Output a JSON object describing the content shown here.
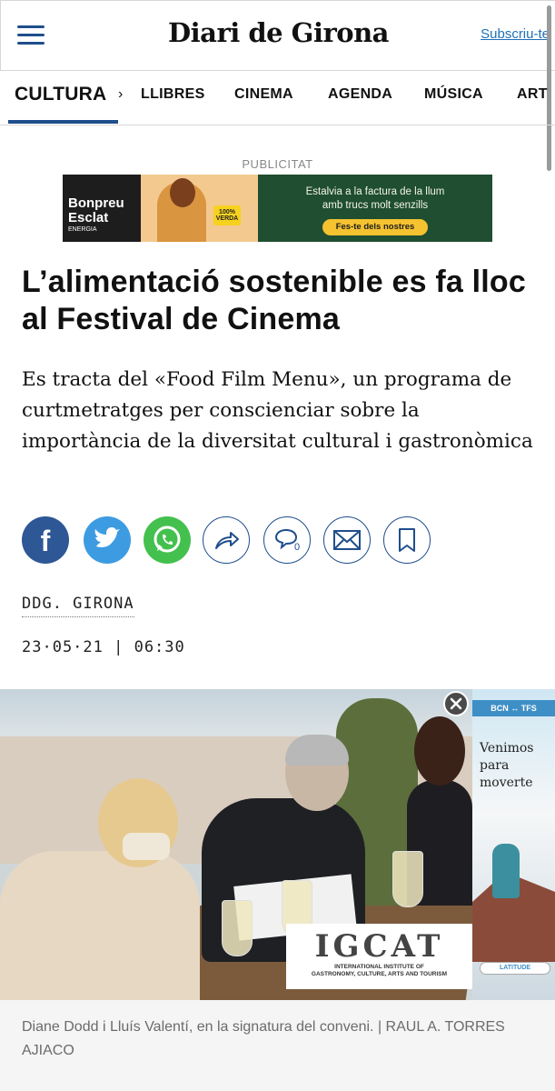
{
  "header": {
    "logo": "Diari de Girona",
    "subscribe": "Subscriu-te"
  },
  "section_nav": {
    "current": "CULTURA",
    "items": [
      "LLIBRES",
      "CINEMA",
      "AGENDA",
      "MÚSICA",
      "ART"
    ]
  },
  "ad": {
    "label": "PUBLICITAT",
    "brand_line1": "Bonpreu",
    "brand_line2": "Esclat",
    "brand_small": "ENERGIA",
    "badge": "100% VERDA",
    "message_line1": "Estalvia a la factura de la llum",
    "message_line2": "amb trucs molt senzills",
    "cta": "Fes-te dels nostres"
  },
  "article": {
    "headline": "L’alimentació sostenible es fa lloc al Festival de Cinema",
    "subtitle": "Es tracta del «Food Film Menu», un programa de curtmetratges per conscienciar sobre la importància de la diversitat cultural i gastronòmica",
    "author": "DDG. GIRONA",
    "date": "23·05·21 | 06:30",
    "caption": "Diane Dodd i Lluís Valentí, en la signatura del conveni. | RAUL A. TORRES AJIACO"
  },
  "share": [
    "facebook-icon",
    "twitter-icon",
    "whatsapp-icon",
    "share-icon",
    "comment-icon",
    "mail-icon",
    "bookmark-icon"
  ],
  "comment_count": "0",
  "photo_sign": {
    "logo": "IGCAT",
    "line1": "INTERNATIONAL INSTITUTE OF",
    "line2": "GASTRONOMY, CULTURE, ARTS AND TOURISM"
  },
  "side_ad": {
    "route": "BCN ↔ TFS",
    "slogan": "Venimos para moverte",
    "airline": "LATITUDE"
  },
  "colors": {
    "brand_blue": "#1f4e8c",
    "facebook": "#2e5796",
    "twitter": "#3d9be2",
    "whatsapp": "#44c04e"
  }
}
